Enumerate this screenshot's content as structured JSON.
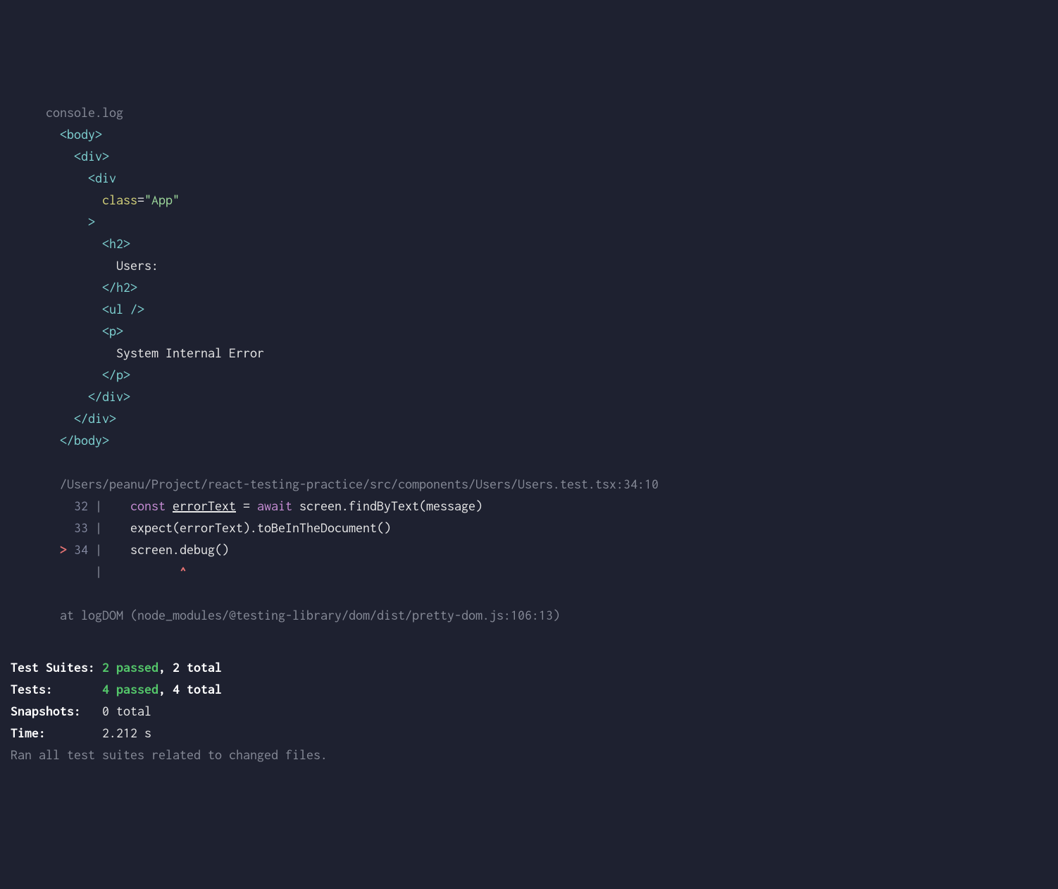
{
  "header": {
    "label": "console.log"
  },
  "dom": {
    "open_body": "<body>",
    "open_div1": "<div>",
    "open_div2": "<div",
    "class_attr": "class",
    "equals": "=",
    "class_val": "\"App\"",
    "close_open_tag": ">",
    "open_h2": "<h2>",
    "h2_text": "Users:",
    "close_h2": "</h2>",
    "ul_self": "<ul />",
    "open_p": "<p>",
    "p_text": "System Internal Error",
    "close_p": "</p>",
    "close_div2": "</div>",
    "close_div1": "</div>",
    "close_body": "</body>"
  },
  "trace": {
    "file_path": "/Users/peanu/Project/react-testing-practice/src/components/Users/Users.test.tsx:34:10",
    "line32_num": "32",
    "line32_pipe": " |",
    "line32_const": "const",
    "line32_var": "errorText",
    "line32_eq": " = ",
    "line32_await": "await",
    "line32_rest": " screen.findByText(message)",
    "line33_num": "33",
    "line33_pipe": " |",
    "line33_code": "    expect(errorText).toBeInTheDocument()",
    "line34_caret": "> ",
    "line34_num": "34",
    "line34_pipe": " |",
    "line34_code": "    screen.debug()",
    "line_blank_pipe": "   |",
    "caret_indent": "           ",
    "caret": "^",
    "at_line": "at logDOM (node_modules/@testing-library/dom/dist/pretty-dom.js:106:13)"
  },
  "summary": {
    "suites_label": "Test Suites: ",
    "suites_passed": "2 passed",
    "suites_total": ", 2 total",
    "tests_label": "Tests:       ",
    "tests_passed": "4 passed",
    "tests_total": ", 4 total",
    "snapshots_label": "Snapshots:   ",
    "snapshots_val": "0 total",
    "time_label": "Time:        ",
    "time_val": "2.212 s",
    "ran_line": "Ran all test suites related to changed files."
  }
}
